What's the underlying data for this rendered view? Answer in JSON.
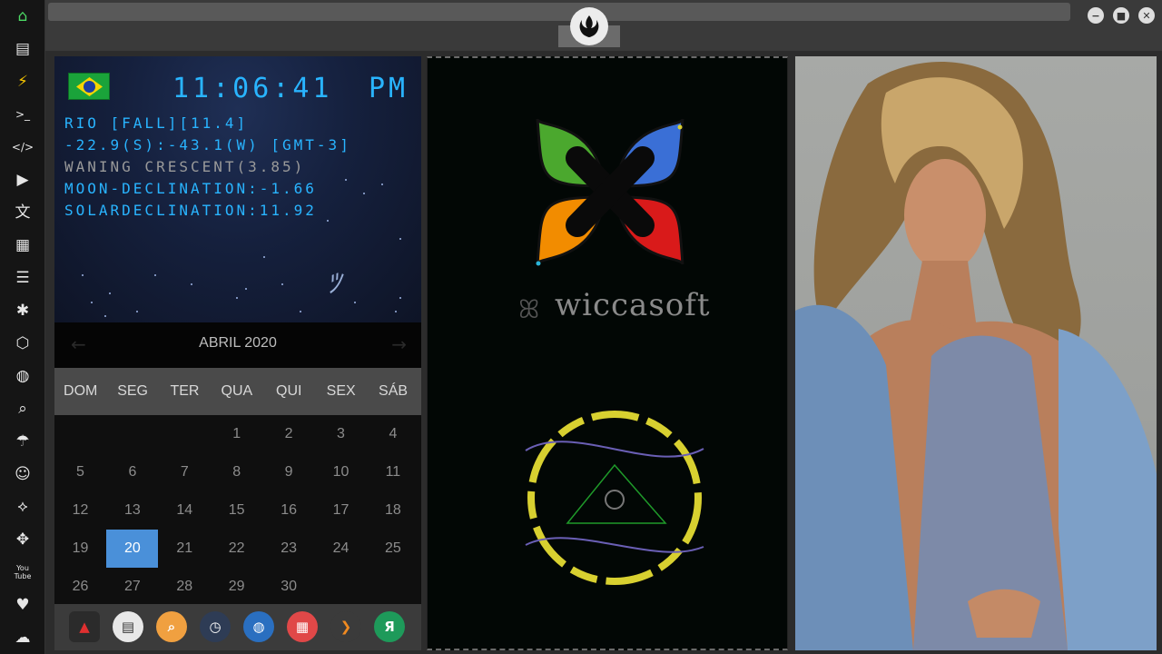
{
  "sidebar": {
    "items": [
      {
        "icon": "home-icon",
        "symbol": "⌂"
      },
      {
        "icon": "document-icon",
        "symbol": "▤"
      },
      {
        "icon": "lightning-icon",
        "symbol": "⚡"
      },
      {
        "icon": "terminal-icon",
        "symbol": ">_"
      },
      {
        "icon": "code-icon",
        "symbol": "</>"
      },
      {
        "icon": "play-icon",
        "symbol": "▶"
      },
      {
        "icon": "translate-icon",
        "symbol": "文"
      },
      {
        "icon": "image-icon",
        "symbol": "▦"
      },
      {
        "icon": "news-icon",
        "symbol": "☰"
      },
      {
        "icon": "asterisk-icon",
        "symbol": "✱"
      },
      {
        "icon": "cube-icon",
        "symbol": "⬡"
      },
      {
        "icon": "globe-icon",
        "symbol": "◍"
      },
      {
        "icon": "search-icon",
        "symbol": "⌕"
      },
      {
        "icon": "umbrella-icon",
        "symbol": "☂"
      },
      {
        "icon": "contact-card-icon",
        "symbol": "☺"
      },
      {
        "icon": "link-icon",
        "symbol": "⟡"
      },
      {
        "icon": "expand-icon",
        "symbol": "✥"
      },
      {
        "icon": "youtube-icon",
        "symbol": "You Tube"
      },
      {
        "icon": "heart-icon",
        "symbol": "♥"
      },
      {
        "icon": "cloud-icon",
        "symbol": "☁"
      }
    ]
  },
  "window": {
    "minimize": "−",
    "maximize": "■",
    "close": "✕"
  },
  "clock": {
    "time": "11:06:41",
    "ampm": "PM",
    "lines": [
      {
        "text": "RIO [FALL][11.4]",
        "grey": false
      },
      {
        "text": "-22.9(S):-43.1(W) [GMT-3]",
        "grey": false
      },
      {
        "text": "WANING CRESCENT(3.85)",
        "grey": true
      },
      {
        "text": "MOON-DECLINATION:-1.66",
        "grey": false
      },
      {
        "text": "SOLARDECLINATION:11.92",
        "grey": false
      }
    ]
  },
  "calendar": {
    "prev": "←",
    "next": "→",
    "month": "ABRIL 2020",
    "weekdays": [
      "DOM",
      "SEG",
      "TER",
      "QUA",
      "QUI",
      "SEX",
      "SÁB"
    ],
    "weeks": [
      [
        "",
        "",
        "",
        "1",
        "2",
        "3",
        "4"
      ],
      [
        "5",
        "6",
        "7",
        "8",
        "9",
        "10",
        "11"
      ],
      [
        "12",
        "13",
        "14",
        "15",
        "16",
        "17",
        "18"
      ],
      [
        "19",
        "20",
        "21",
        "22",
        "23",
        "24",
        "25"
      ],
      [
        "26",
        "27",
        "28",
        "29",
        "30",
        "",
        ""
      ]
    ],
    "selected_day": "20"
  },
  "dock": {
    "apps": [
      {
        "icon": "app-red-triangle-icon",
        "color": "#2b2b2b",
        "glyph": "▲"
      },
      {
        "icon": "news-app-icon",
        "color": "#e8e8e8",
        "glyph": "▤"
      },
      {
        "icon": "search-app-icon",
        "color": "#f0a040",
        "glyph": "⌕"
      },
      {
        "icon": "clock-app-icon",
        "color": "#2e3c55",
        "glyph": "◷"
      },
      {
        "icon": "globe-app-icon",
        "color": "#2a6fc0",
        "glyph": "◍"
      },
      {
        "icon": "calendar-app-icon",
        "color": "#e04848",
        "glyph": "▦"
      },
      {
        "icon": "arrow-app-icon",
        "color": "#3b3b3b",
        "glyph": "❯"
      },
      {
        "icon": "yandex-app-icon",
        "color": "#1e9a5a",
        "glyph": "Я"
      }
    ]
  },
  "brand": {
    "name": "wiccasoft",
    "petal_colors": [
      "#4ba82e",
      "#3a6fd6",
      "#f28c00",
      "#d91a1a"
    ],
    "ring_color": "#d8d030",
    "wave_color": "#6a5fb5",
    "triangle_color": "#1f9a2a"
  }
}
